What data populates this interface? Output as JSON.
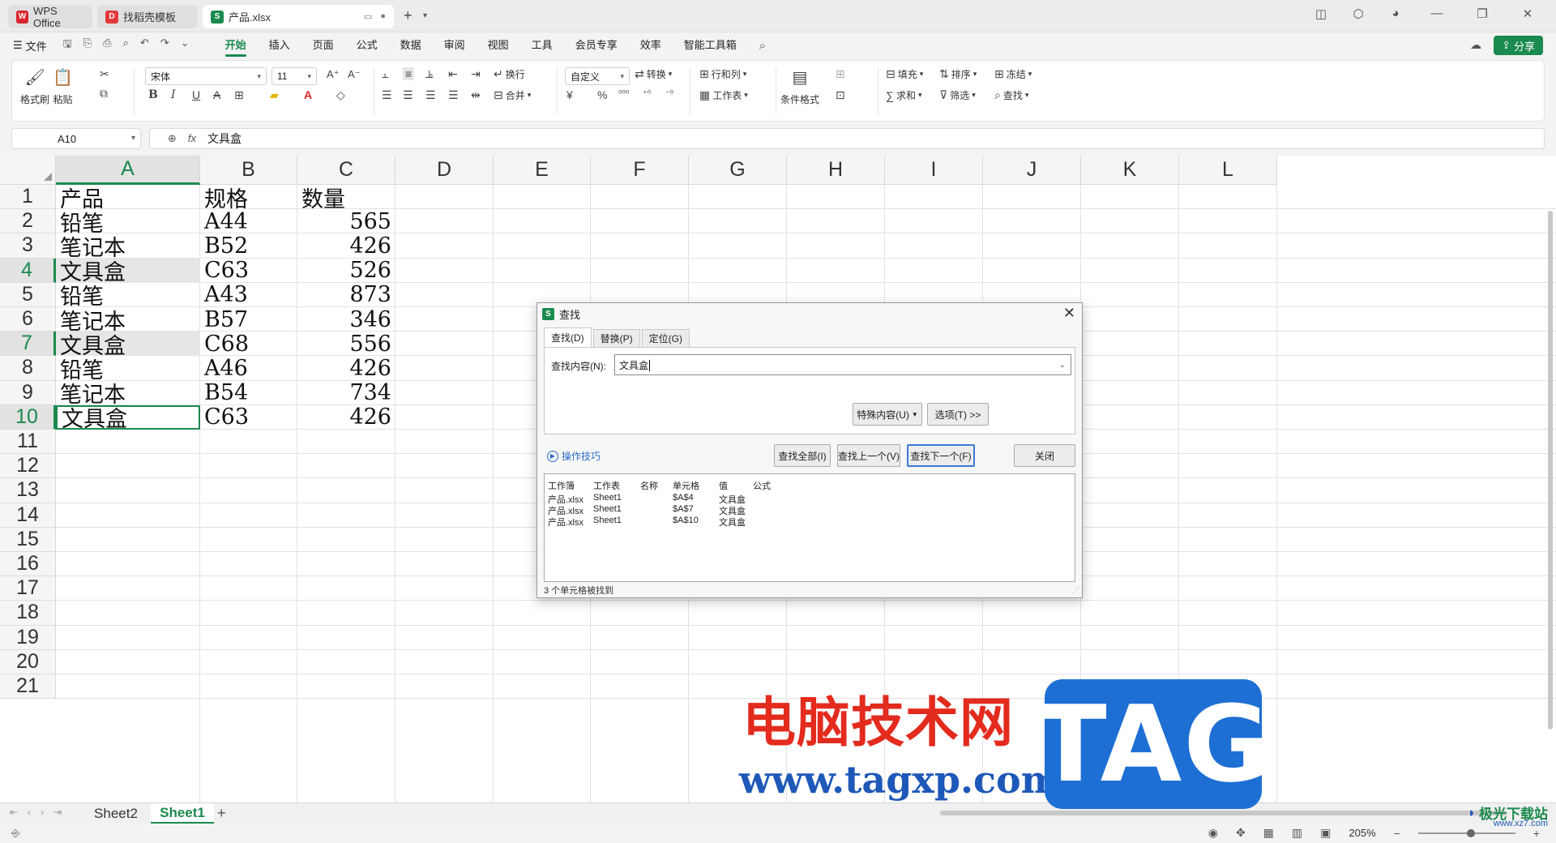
{
  "window": {
    "tabs": [
      {
        "label": "WPS Office",
        "logo": "W"
      },
      {
        "label": "找稻壳模板",
        "logo": "D"
      },
      {
        "label": "产品.xlsx",
        "logo": "S"
      }
    ]
  },
  "menu": {
    "file": "文件",
    "items": [
      "开始",
      "插入",
      "页面",
      "公式",
      "数据",
      "审阅",
      "视图",
      "工具",
      "会员专享",
      "效率",
      "智能工具箱"
    ],
    "active": "开始",
    "share": "分享"
  },
  "ribbon": {
    "format_painter": "格式刷",
    "paste": "粘贴",
    "font_name": "宋体",
    "font_size": "11",
    "wrap": "换行",
    "merge": "合并",
    "number_format": "自定义",
    "convert": "转换",
    "rows_cols": "行和列",
    "worksheet": "工作表",
    "cond_format": "条件格式",
    "fill": "填充",
    "sort": "排序",
    "freeze": "冻结",
    "sum": "求和",
    "filter": "筛选",
    "find": "查找"
  },
  "formula_bar": {
    "name_box": "A10",
    "fx": "fx",
    "content": "文具盒"
  },
  "sheet": {
    "columns": [
      "A",
      "B",
      "C",
      "D",
      "E",
      "F",
      "G",
      "H",
      "I",
      "J",
      "K",
      "L"
    ],
    "selected_column": "A",
    "rows": [
      "1",
      "2",
      "3",
      "4",
      "5",
      "6",
      "7",
      "8",
      "9",
      "10",
      "11",
      "12",
      "13",
      "14",
      "15",
      "16",
      "17",
      "18",
      "19",
      "20",
      "21"
    ],
    "selected_rows": [
      "4",
      "7",
      "10"
    ],
    "data": [
      [
        "产品",
        "规格",
        "数量"
      ],
      [
        "铅笔",
        "A44",
        "565"
      ],
      [
        "笔记本",
        "B52",
        "426"
      ],
      [
        "文具盒",
        "C63",
        "526"
      ],
      [
        "铅笔",
        "A43",
        "873"
      ],
      [
        "笔记本",
        "B57",
        "346"
      ],
      [
        "文具盒",
        "C68",
        "556"
      ],
      [
        "铅笔",
        "A46",
        "426"
      ],
      [
        "笔记本",
        "B54",
        "734"
      ],
      [
        "文具盒",
        "C63",
        "426"
      ]
    ]
  },
  "sheet_tabs": [
    "Sheet2",
    "Sheet1"
  ],
  "active_sheet": "Sheet1",
  "status": {
    "zoom": "205%"
  },
  "dialog": {
    "title": "查找",
    "tabs": [
      "查找(D)",
      "替换(P)",
      "定位(G)"
    ],
    "find_label": "查找内容(N):",
    "find_value": "文具盒",
    "special_btn": "特殊内容(U)",
    "options_btn": "选项(T) >>",
    "tips": "操作技巧",
    "find_all": "查找全部(I)",
    "find_prev": "查找上一个(V)",
    "find_next": "查找下一个(F)",
    "close": "关闭",
    "result_headers": [
      "工作簿",
      "工作表",
      "名称",
      "单元格",
      "值",
      "公式"
    ],
    "results": [
      [
        "产品.xlsx",
        "Sheet1",
        "",
        "$A$4",
        "文具盒",
        ""
      ],
      [
        "产品.xlsx",
        "Sheet1",
        "",
        "$A$7",
        "文具盒",
        ""
      ],
      [
        "产品.xlsx",
        "Sheet1",
        "",
        "$A$10",
        "文具盒",
        ""
      ]
    ],
    "status": "3 个单元格被找到"
  },
  "watermark": {
    "cn": "电脑技术网",
    "url": "www.tagxp.com",
    "tag": "TAG",
    "site": "极光下载站",
    "site_url": "www.xz7.com"
  }
}
